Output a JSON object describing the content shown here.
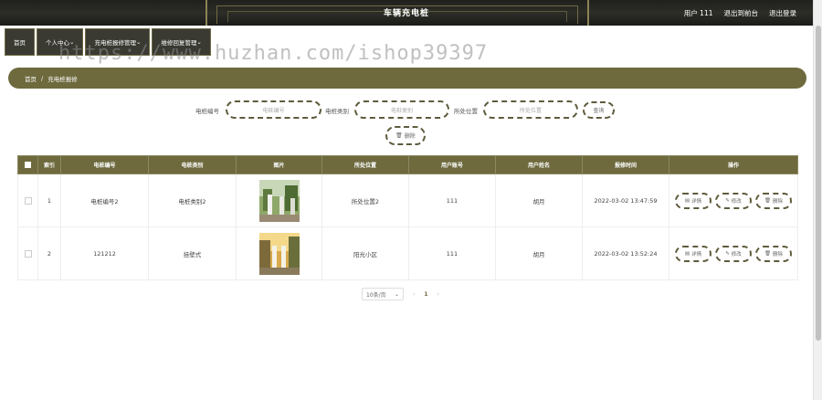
{
  "header": {
    "title": "车辆充电桩",
    "user": "用户 111",
    "back_link": "退出到前台",
    "logout_link": "退出登录"
  },
  "menu": {
    "items": [
      {
        "label": "首页"
      },
      {
        "label": "个人中心"
      },
      {
        "label": "充电桩报修管理"
      },
      {
        "label": "维修回复管理"
      }
    ]
  },
  "watermark": "https://www.huzhan.com/ishop39397",
  "breadcrumb": {
    "home": "首页",
    "sep": "/",
    "current": "充电桩报修"
  },
  "search": {
    "field1_label": "电桩编号",
    "field1_placeholder": "电桩编号",
    "field2_label": "电桩类别",
    "field2_placeholder": "电桩类别",
    "field3_label": "所处位置",
    "field3_placeholder": "所处位置",
    "query_label": "查询",
    "delete_label": "删除"
  },
  "table": {
    "columns": [
      "索引",
      "电桩编号",
      "电桩类别",
      "图片",
      "所处位置",
      "用户账号",
      "用户姓名",
      "报修时间",
      "操作"
    ],
    "rows": [
      {
        "index": "1",
        "code": "电桩编号2",
        "category": "电桩类别2",
        "location": "所处位置2",
        "account": "111",
        "name": "胡月",
        "time": "2022-03-02 13:47:59"
      },
      {
        "index": "2",
        "code": "121212",
        "category": "挂壁式",
        "location": "阳光小区",
        "account": "111",
        "name": "胡月",
        "time": "2022-03-02 13:52:24"
      }
    ],
    "actions": {
      "detail": "详情",
      "edit": "修改",
      "delete": "删除"
    }
  },
  "pagination": {
    "page_size": "10条/页",
    "current_page": "1"
  },
  "colors": {
    "accent": "#6e6a3e",
    "header_bg": "#2e2e28"
  }
}
